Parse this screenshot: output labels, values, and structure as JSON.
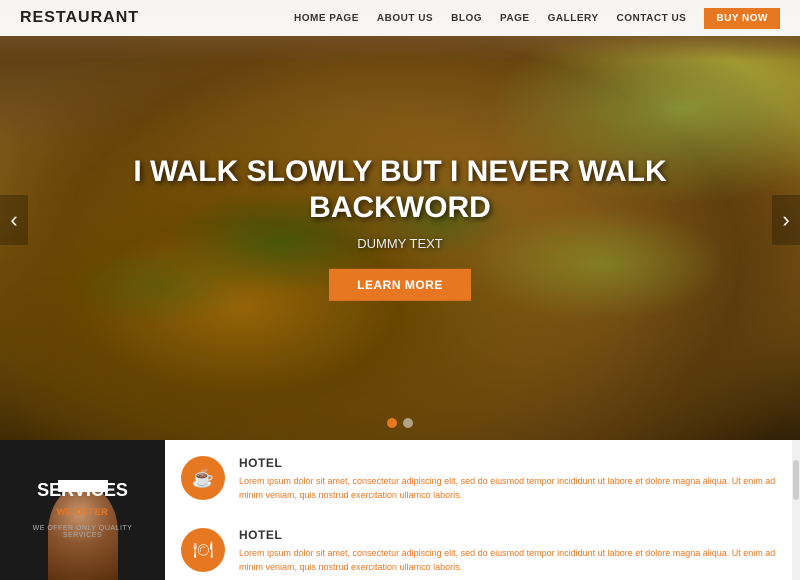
{
  "header": {
    "logo": "RESTAURANT",
    "nav": [
      {
        "label": "HOME PAGE",
        "id": "home"
      },
      {
        "label": "ABOUT US",
        "id": "about"
      },
      {
        "label": "BLOG",
        "id": "blog"
      },
      {
        "label": "PAGE",
        "id": "page"
      },
      {
        "label": "GALLERY",
        "id": "gallery"
      },
      {
        "label": "CONTACT US",
        "id": "contact"
      }
    ],
    "buy_now": "BUY NOW"
  },
  "hero": {
    "title": "I WALK SLOWLY BUT I NEVER WALK BACKWORD",
    "subtitle": "DUMMY TEXT",
    "cta_label": "Learn More",
    "dots": [
      {
        "active": true
      },
      {
        "active": false
      }
    ]
  },
  "arrows": {
    "left": "‹",
    "right": "›"
  },
  "services": {
    "panel_title": "SERVICES",
    "panel_subtitle": "WE OFFER",
    "panel_desc": "WE OFFER ONLY QUALITY SERVICES",
    "items": [
      {
        "icon": "☕",
        "title": "HOTEL",
        "text": "Lorem ipsum dolor sit amet, consectetur adipiscing elit, sed do eiusmod tempor incididunt ut labore et dolore magna aliqua. Ut enim ad minim veniam, quis nostrud exercitation ullamco laboris.",
        "icon_name": "coffee-cup-icon"
      },
      {
        "icon": "🍽",
        "title": "HOTEL",
        "text": "Lorem ipsum dolor sit amet, consectetur adipiscing elit, sed do eiusmod tempor incididunt ut labore et dolore magna aliqua. Ut enim ad minim veniam, quis nostrud exercitation ullamco laboris.",
        "icon_name": "fork-plate-icon"
      }
    ]
  }
}
